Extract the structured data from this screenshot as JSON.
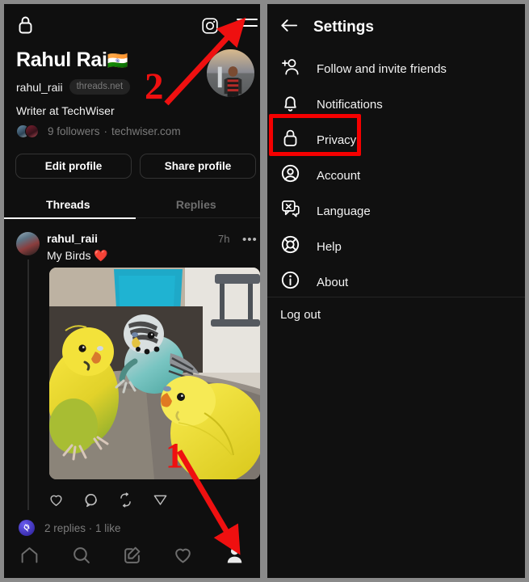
{
  "colors": {
    "bg_dark": "#0f0f0f",
    "panel_frame": "#8a8a8a",
    "annotation_red": "#f50000",
    "text_primary": "#f2f2f2",
    "text_muted": "#7b7b7b"
  },
  "left_panel": {
    "topbar": {
      "lock_icon": "lock-icon",
      "instagram_icon": "instagram-icon",
      "menu_icon": "hamburger-menu-icon"
    },
    "profile": {
      "display_name": "Rahul Rai",
      "flag": "🇮🇳",
      "username": "rahul_raii",
      "domain_badge": "threads.net",
      "bio": "Writer at TechWiser",
      "followers": "9 followers",
      "separator": "·",
      "link": "techwiser.com",
      "avatar_alt": "profile-picture",
      "buttons": {
        "edit": "Edit profile",
        "share": "Share profile"
      }
    },
    "tabs": [
      {
        "label": "Threads",
        "active": true
      },
      {
        "label": "Replies",
        "active": false
      }
    ],
    "post": {
      "username": "rahul_raii",
      "timestamp": "7h",
      "more_label": "•••",
      "text": "My Birds ❤️",
      "image_alt": "three-budgerigar-parakeets-on-grey-couch",
      "actions": [
        "like-icon",
        "comment-icon",
        "repost-icon",
        "share-icon"
      ],
      "stats": "2 replies · 1 like"
    },
    "navbar": [
      "home-icon",
      "search-icon",
      "compose-icon",
      "activity-heart-icon",
      "profile-icon"
    ]
  },
  "right_panel": {
    "header": {
      "back_label": "back-arrow-icon",
      "title": "Settings"
    },
    "items": [
      {
        "label": "Follow and invite friends",
        "icon": "add-person-icon"
      },
      {
        "label": "Notifications",
        "icon": "bell-icon"
      },
      {
        "label": "Privacy",
        "icon": "lock-icon"
      },
      {
        "label": "Account",
        "icon": "account-circle-icon"
      },
      {
        "label": "Language",
        "icon": "language-translate-icon"
      },
      {
        "label": "Help",
        "icon": "lifebuoy-help-icon"
      },
      {
        "label": "About",
        "icon": "info-circle-icon"
      }
    ],
    "logout": "Log out"
  },
  "annotations": {
    "step_one": "1",
    "step_two": "2",
    "highlight_target": "Privacy"
  }
}
